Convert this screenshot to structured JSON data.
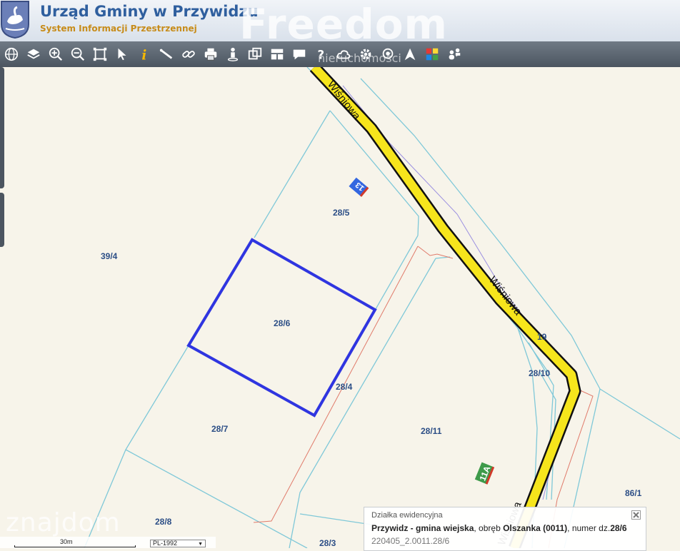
{
  "header": {
    "title": "Urząd Gminy w Przywidzu",
    "subtitle": "System Informacji Przestrzennej"
  },
  "watermarks": {
    "freedom": "Freedom",
    "freedom_sub": "nieruchomości",
    "zn": "znajdom"
  },
  "toolbar": {
    "icons": [
      "globe-icon",
      "layers-icon",
      "zoom-in-icon",
      "zoom-out-icon",
      "zoom-extent-icon",
      "select-pointer-icon",
      "info-icon",
      "measure-distance-icon",
      "link-icon",
      "print-icon",
      "street-view-icon",
      "copy-window-icon",
      "layout-icon",
      "comment-icon",
      "help-icon",
      "cloud-icon",
      "settings-icon",
      "search-location-icon",
      "north-arrow-icon",
      "color-palette-icon",
      "users-icon"
    ]
  },
  "map": {
    "street_name": "Wiśniowa",
    "street_name_2": "Wiśniowa",
    "house_numbers": [
      "13",
      "11A"
    ],
    "plots": [
      "39/4",
      "28/5",
      "28/6",
      "28/4",
      "28/7",
      "28/11",
      "28/10",
      "19",
      "86/1",
      "28/8",
      "28/3"
    ],
    "selected_plot": "28/6",
    "colors": {
      "road": "#f6e51c",
      "parcel_line": "#7fc8d8",
      "selected": "#2f35e0",
      "plot_label": "#2c4e86"
    }
  },
  "infobox": {
    "heading": "Działka ewidencyjna",
    "gmina": "Przywidz - gmina wiejska",
    "sep1": ", obręb ",
    "obreb": "Olszanka (0011)",
    "sep2": ", numer dz.",
    "numer": "28/6",
    "identifier": "220405_2.0011.28/6"
  },
  "scale": {
    "label": "30m",
    "crs": "PL-1992"
  }
}
